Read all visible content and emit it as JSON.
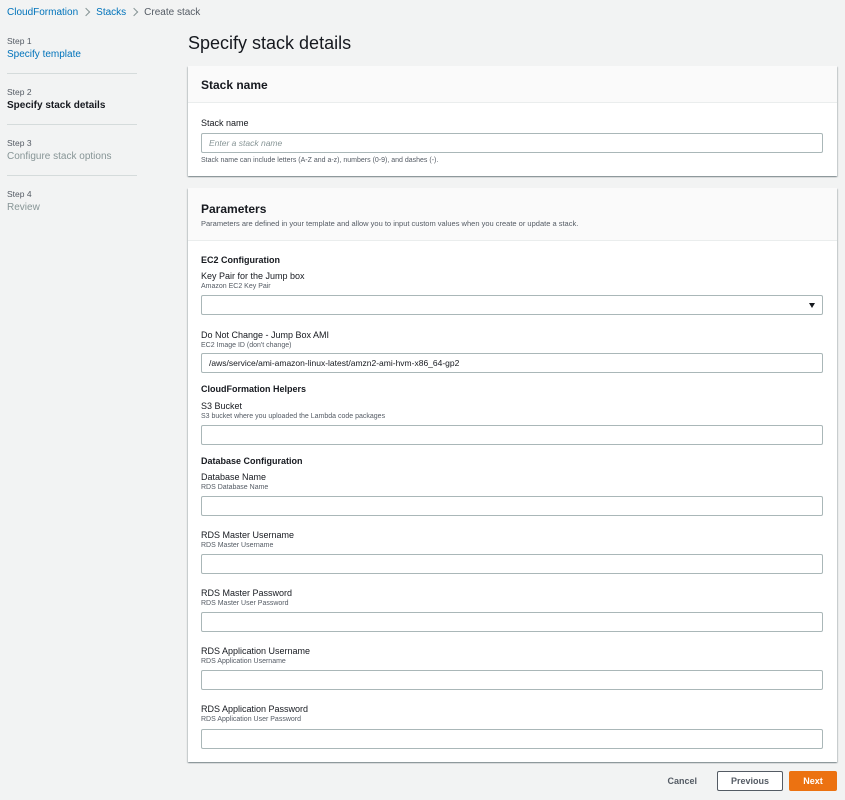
{
  "breadcrumb": {
    "items": [
      "CloudFormation",
      "Stacks"
    ],
    "current": "Create stack"
  },
  "steps": [
    {
      "num": "Step 1",
      "label": "Specify template",
      "state": "link"
    },
    {
      "num": "Step 2",
      "label": "Specify stack details",
      "state": "current"
    },
    {
      "num": "Step 3",
      "label": "Configure stack options",
      "state": "disabled"
    },
    {
      "num": "Step 4",
      "label": "Review",
      "state": "disabled"
    }
  ],
  "page_title": "Specify stack details",
  "stack_panel": {
    "title": "Stack name",
    "field_label": "Stack name",
    "placeholder": "Enter a stack name",
    "hint": "Stack name can include letters (A-Z and a-z), numbers (0-9), and dashes (-)."
  },
  "params_panel": {
    "title": "Parameters",
    "description": "Parameters are defined in your template and allow you to input custom values when you create or update a stack.",
    "sections": {
      "ec2": "EC2 Configuration",
      "cfn_helpers": "CloudFormation Helpers",
      "database": "Database Configuration"
    },
    "fields": {
      "key_pair": {
        "label": "Key Pair for the Jump box",
        "desc": "Amazon EC2 Key Pair",
        "value": ""
      },
      "ami": {
        "label": "Do Not Change - Jump Box AMI",
        "desc": "EC2 Image ID (don't change)",
        "value": "/aws/service/ami-amazon-linux-latest/amzn2-ami-hvm-x86_64-gp2"
      },
      "s3_bucket": {
        "label": "S3 Bucket",
        "desc": "S3 bucket where you uploaded the Lambda code packages",
        "value": ""
      },
      "db_name": {
        "label": "Database Name",
        "desc": "RDS Database Name",
        "value": ""
      },
      "master_user": {
        "label": "RDS Master Username",
        "desc": "RDS Master Username",
        "value": ""
      },
      "master_pass": {
        "label": "RDS Master Password",
        "desc": "RDS Master User Password",
        "value": ""
      },
      "app_user": {
        "label": "RDS Application Username",
        "desc": "RDS Application Username",
        "value": ""
      },
      "app_pass": {
        "label": "RDS Application Password",
        "desc": "RDS Application User Password",
        "value": ""
      }
    }
  },
  "footer": {
    "cancel": "Cancel",
    "previous": "Previous",
    "next": "Next"
  },
  "colors": {
    "accent": "#ec7211",
    "link": "#0073bb",
    "background": "#f2f3f3"
  }
}
